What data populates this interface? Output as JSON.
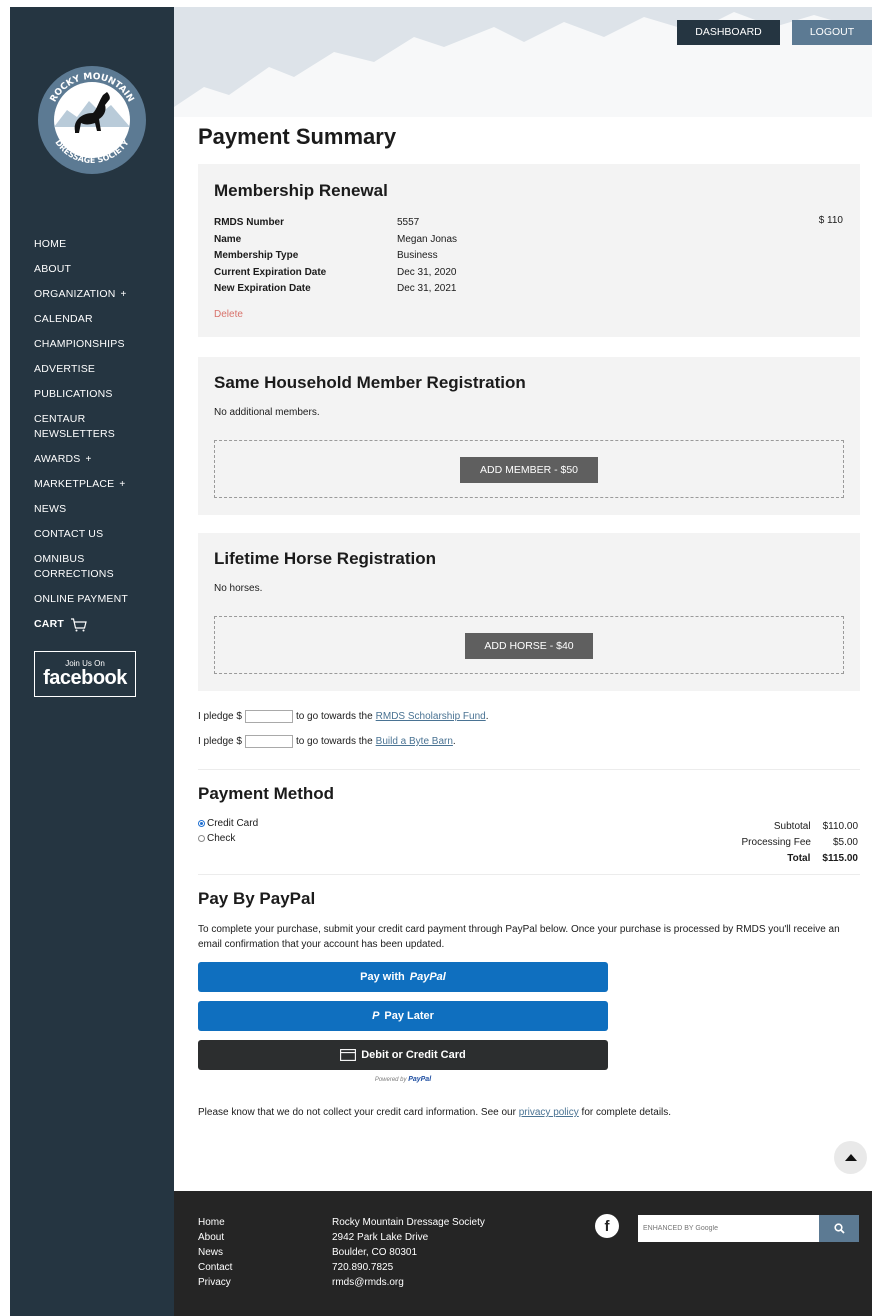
{
  "header": {
    "dashboard_label": "DASHBOARD",
    "logout_label": "LOGOUT"
  },
  "logo": {
    "top_text": "ROCKY MOUNTAIN",
    "bottom_text": "DRESSAGE SOCIETY"
  },
  "sidebar": {
    "items": [
      {
        "label": "HOME",
        "has_submenu": false
      },
      {
        "label": "ABOUT",
        "has_submenu": false
      },
      {
        "label": "ORGANIZATION",
        "has_submenu": true
      },
      {
        "label": "CALENDAR",
        "has_submenu": false
      },
      {
        "label": "CHAMPIONSHIPS",
        "has_submenu": false
      },
      {
        "label": "ADVERTISE",
        "has_submenu": false
      },
      {
        "label": "PUBLICATIONS",
        "has_submenu": false
      },
      {
        "label": "CENTAUR NEWSLETTERS",
        "has_submenu": false
      },
      {
        "label": "AWARDS",
        "has_submenu": true
      },
      {
        "label": "MARKETPLACE",
        "has_submenu": true
      },
      {
        "label": "NEWS",
        "has_submenu": false
      },
      {
        "label": "CONTACT US",
        "has_submenu": false
      },
      {
        "label": "OMNIBUS CORRECTIONS",
        "has_submenu": false
      },
      {
        "label": "ONLINE PAYMENT",
        "has_submenu": false
      }
    ],
    "cart_label": "CART",
    "facebook_small": "Join Us On",
    "facebook_big": "facebook"
  },
  "page": {
    "title": "Payment Summary"
  },
  "membership": {
    "title": "Membership Renewal",
    "rows": [
      {
        "label": "RMDS Number",
        "value": "5557"
      },
      {
        "label": "Name",
        "value": "Megan Jonas"
      },
      {
        "label": "Membership Type",
        "value": "Business"
      },
      {
        "label": "Current Expiration Date",
        "value": "Dec 31, 2020"
      },
      {
        "label": "New Expiration Date",
        "value": "Dec 31, 2021"
      }
    ],
    "price": "$ 110",
    "delete_label": "Delete"
  },
  "household": {
    "title": "Same Household Member Registration",
    "note": "No additional members.",
    "button_label": "ADD MEMBER - $50"
  },
  "horse": {
    "title": "Lifetime Horse Registration",
    "note": "No horses.",
    "button_label": "ADD HORSE - $40"
  },
  "pledges": [
    {
      "prefix": "I pledge $",
      "middle": "to go towards the",
      "link": "RMDS Scholarship Fund",
      "suffix": "."
    },
    {
      "prefix": "I pledge $",
      "middle": "to go towards the",
      "link": "Build a Byte Barn",
      "suffix": "."
    }
  ],
  "payment_method": {
    "title": "Payment Method",
    "options": [
      {
        "label": "Credit Card",
        "selected": true
      },
      {
        "label": "Check",
        "selected": false
      }
    ],
    "totals": [
      {
        "label": "Subtotal",
        "value": "$110.00"
      },
      {
        "label": "Processing Fee",
        "value": "$5.00"
      },
      {
        "label": "Total",
        "value": "$115.00"
      }
    ]
  },
  "paypal": {
    "title": "Pay By PayPal",
    "description": "To complete your purchase, submit your credit card payment through PayPal below. Once your purchase is processed by RMDS you'll receive an email confirmation that your account has been updated.",
    "pay_with_prefix": "Pay with",
    "pay_with_brand": "PayPal",
    "pay_later_label": "Pay Later",
    "card_label": "Debit or Credit Card",
    "powered_prefix": "Powered by",
    "powered_brand": "PayPal",
    "privacy_before": "Please know that we do not collect your credit card information. See our",
    "privacy_link": "privacy policy",
    "privacy_after": "for complete details.",
    "brand_color": "#0f6fbf"
  },
  "footer": {
    "links": [
      "Home",
      "About",
      "News",
      "Contact",
      "Privacy"
    ],
    "address": [
      "Rocky Mountain Dressage Society",
      "2942 Park Lake Drive",
      "Boulder, CO 80301",
      "720.890.7825",
      "rmds@rmds.org"
    ],
    "search_placeholder": "ENHANCED BY Google"
  },
  "colors": {
    "sidebar_bg": "#253541",
    "accent_blue": "#5c7a93",
    "delete_red": "#d8726b",
    "footer_bg": "#252525"
  }
}
